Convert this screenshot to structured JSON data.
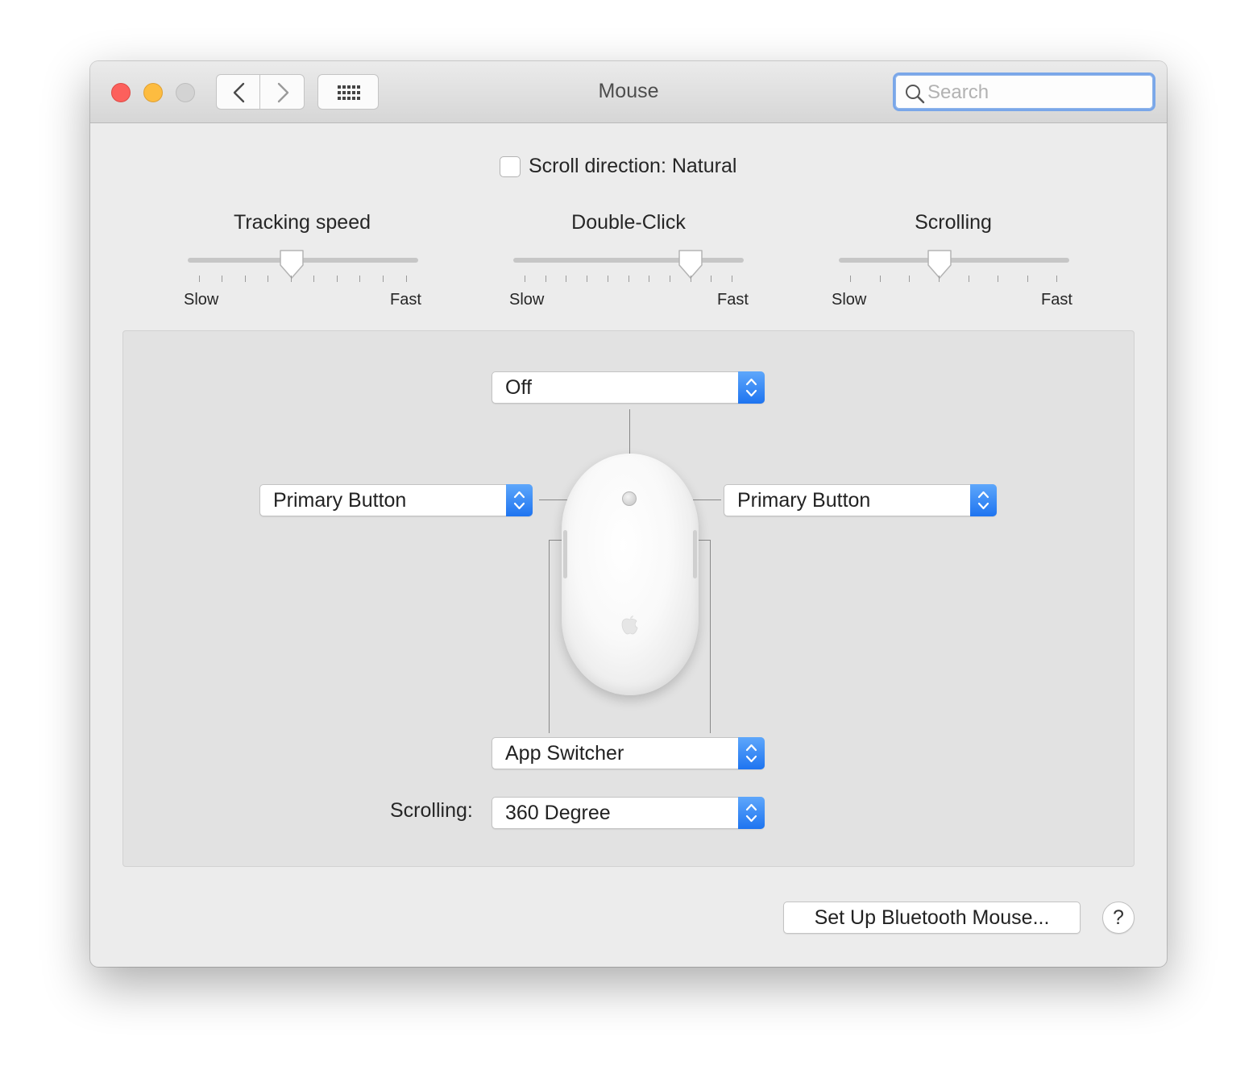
{
  "window": {
    "title": "Mouse",
    "search_placeholder": "Search"
  },
  "toolbar": {
    "back_icon": "chevron-left-icon",
    "forward_icon": "chevron-right-icon",
    "grid_icon": "grid-icon"
  },
  "scroll_direction": {
    "label": "Scroll direction: Natural",
    "checked": false
  },
  "sliders": [
    {
      "title": "Tracking speed",
      "min_label": "Slow",
      "max_label": "Fast",
      "ticks": 10,
      "value": 0.45
    },
    {
      "title": "Double-Click",
      "min_label": "Slow",
      "max_label": "Fast",
      "ticks": 11,
      "value": 0.77
    },
    {
      "title": "Scrolling",
      "min_label": "Slow",
      "max_label": "Fast",
      "ticks": 8,
      "value": 0.43
    }
  ],
  "mouse_buttons": {
    "top": "Off",
    "left": "Primary Button",
    "right": "Primary Button",
    "bottom": "App Switcher"
  },
  "scrolling": {
    "label": "Scrolling:",
    "value": "360 Degree"
  },
  "footer": {
    "setup_button": "Set Up Bluetooth Mouse...",
    "help_button": "?"
  },
  "colors": {
    "accent": "#1e74f0",
    "close": "#fc605c",
    "minimize": "#fdbc40",
    "zoom_disabled": "#d3d3d3"
  }
}
